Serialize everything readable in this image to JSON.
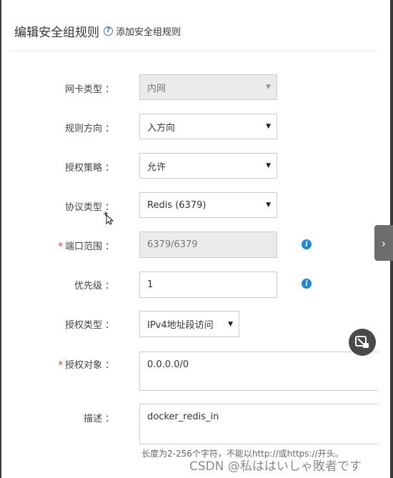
{
  "header": {
    "title": "编辑安全组规则",
    "help_icon": "question-circle-icon",
    "help_link": "添加安全组规则"
  },
  "form": {
    "nic_type": {
      "label": "网卡类型",
      "value": "内网",
      "disabled": true
    },
    "direction": {
      "label": "规则方向",
      "value": "入方向"
    },
    "policy": {
      "label": "授权策略",
      "value": "允许"
    },
    "protocol": {
      "label": "协议类型",
      "value": "Redis (6379)"
    },
    "port_range": {
      "label": "端口范围",
      "value": "6379/6379",
      "required": true,
      "disabled": true
    },
    "priority": {
      "label": "优先级",
      "value": "1"
    },
    "auth_type": {
      "label": "授权类型",
      "value": "IPv4地址段访问"
    },
    "auth_object": {
      "label": "授权对象",
      "value": "0.0.0.0/0",
      "required": true
    },
    "description": {
      "label": "描述",
      "value": "docker_redis_in",
      "hint": "长度为2-256个字符，不能以http://或https://开头。"
    },
    "colon": "："
  },
  "watermark": "CSDN @私ははいしゃ敗者です",
  "colors": {
    "required": "#e0322b",
    "info": "#1e88d8",
    "link": "#2a7fd0"
  }
}
